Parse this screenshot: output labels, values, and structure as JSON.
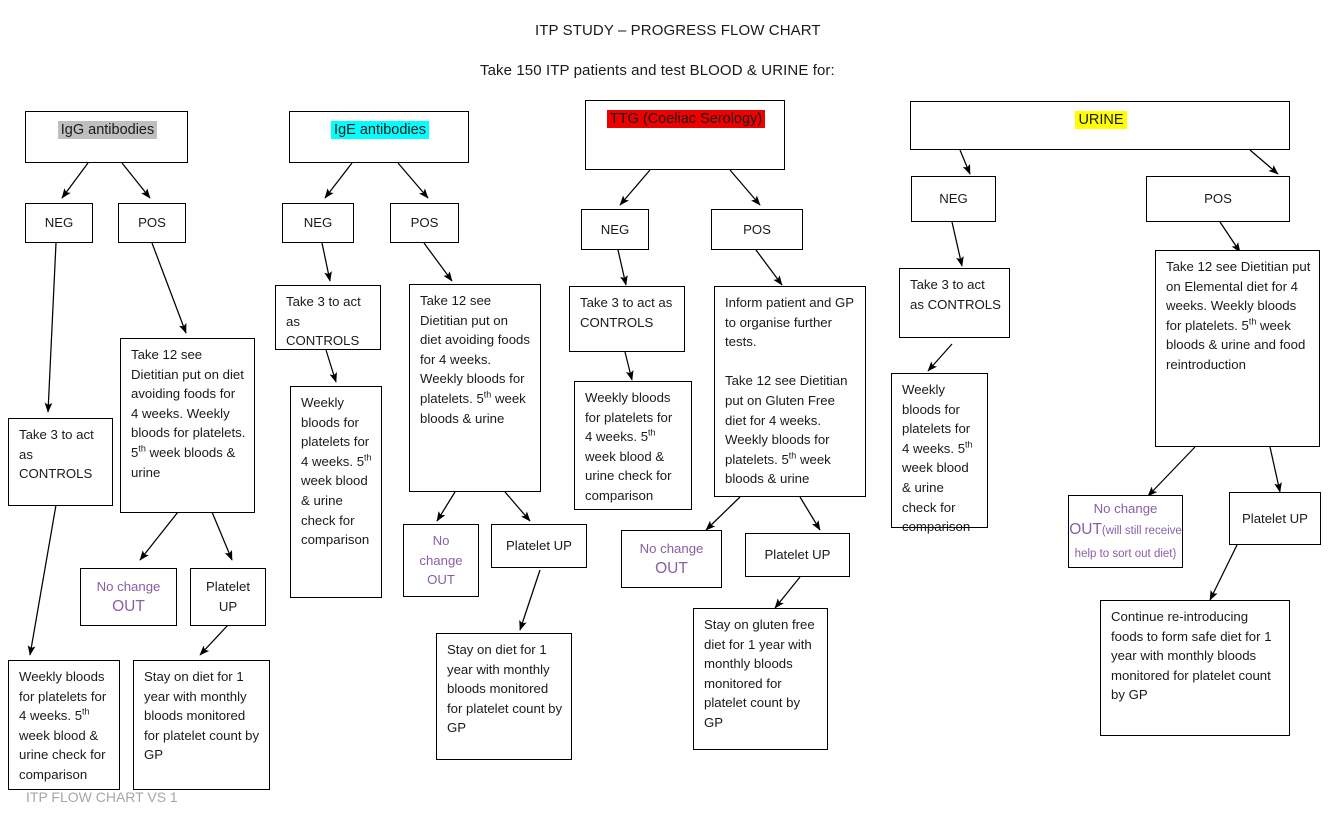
{
  "header": {
    "title": "ITP STUDY – PROGRESS FLOW CHART",
    "subtitle": "Take 150 ITP patients and test BLOOD & URINE for:"
  },
  "footer": {
    "label": "ITP FLOW CHART VS 1"
  },
  "colors": {
    "igg_highlight": "#bfbfbf",
    "ige_highlight": "#00ffff",
    "ttg_highlight": "#ee0000",
    "urine_highlight": "#ffff00",
    "out_text": "#8a5ea8",
    "footer_text": "#a6a6a6",
    "box_border": "#000000"
  },
  "columns": [
    {
      "id": "igg",
      "header": "IgG antibodies",
      "neg": "NEG",
      "pos": "POS",
      "controls": "Take 3 to act as CONTROLS",
      "diet": "Take 12 see Dietitian put on diet avoiding foods for 4 weeks. Weekly bloods for platelets. 5th week bloods & urine",
      "no_change": "No change",
      "out": "OUT",
      "platelet_up": "Platelet UP",
      "control_outcome": "Weekly bloods for platelets for 4 weeks. 5th week blood & urine check for comparison",
      "final": "Stay on diet for 1 year with monthly bloods monitored for platelet count by GP"
    },
    {
      "id": "ige",
      "header": "IgE antibodies",
      "neg": "NEG",
      "pos": "POS",
      "controls": "Take 3 to act as CONTROLS",
      "diet": "Take 12 see Dietitian put on diet avoiding foods for 4 weeks. Weekly bloods for platelets. 5th week bloods & urine",
      "no_change": "No change",
      "out": "OUT",
      "platelet_up": "Platelet UP",
      "control_outcome": "Weekly bloods for platelets for 4 weeks. 5th week blood & urine check for comparison",
      "final": "Stay on diet for 1 year with monthly bloods monitored for platelet count by GP"
    },
    {
      "id": "ttg",
      "header": "TTG (Coeliac Serology)",
      "neg": "NEG",
      "pos": "POS",
      "controls": "Take 3 to act as CONTROLS",
      "diet": "Inform patient and GP to organise further tests.\n\nTake 12 see Dietitian put on Gluten Free diet for 4 weeks. Weekly bloods for platelets. 5th week bloods & urine",
      "no_change": "No change",
      "out": "OUT",
      "platelet_up": "Platelet UP",
      "control_outcome": "Weekly bloods for platelets for 4 weeks. 5th week blood & urine check for comparison",
      "final": "Stay on gluten free diet for 1 year with monthly bloods monitored for platelet count by GP"
    },
    {
      "id": "urine",
      "header": "URINE",
      "neg": "NEG",
      "pos": "POS",
      "controls": "Take 3 to act as CONTROLS",
      "diet": "Take 12 see Dietitian put on Elemental diet for 4 weeks. Weekly bloods for platelets. 5th week bloods & urine and food reintroduction",
      "no_change": "No change",
      "out": "OUT",
      "out_note": "(will still receive help to sort out diet)",
      "platelet_up": "Platelet UP",
      "control_outcome": "Weekly bloods for platelets for 4 weeks. 5th week blood & urine check for comparison",
      "final": "Continue re-introducing foods to form safe diet for 1 year with monthly bloods monitored for platelet count by GP"
    }
  ]
}
